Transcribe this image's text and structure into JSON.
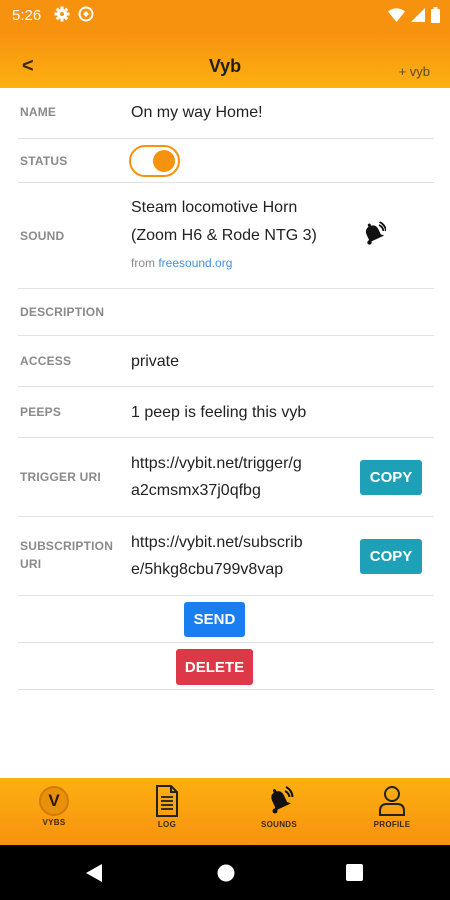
{
  "status_bar": {
    "time": "5:26"
  },
  "header": {
    "back_label": "<",
    "title": "Vyb",
    "add_label": "+ vyb"
  },
  "details": {
    "name": {
      "label": "NAME",
      "value": "On my way Home!"
    },
    "status": {
      "label": "STATUS",
      "enabled": true
    },
    "sound": {
      "label": "SOUND",
      "value_line1": "Steam locomotive Horn",
      "value_line2": "(Zoom H6 & Rode NTG 3)",
      "source_prefix": "from",
      "source_link": "freesound.org"
    },
    "description": {
      "label": "DESCRIPTION",
      "value": ""
    },
    "access": {
      "label": "ACCESS",
      "value": "private"
    },
    "peeps": {
      "label": "PEEPS",
      "value": "1 peep is feeling this vyb"
    },
    "trigger_uri": {
      "label": "TRIGGER URI",
      "value_line1": "https://vybit.net/trigger/g",
      "value_line2": "a2cmsmx37j0qfbg",
      "copy_label": "COPY"
    },
    "subscription_uri": {
      "label_line1": "SUBSCRIPTION",
      "label_line2": "URI",
      "value_line1": "https://vybit.net/subscrib",
      "value_line2": "e/5hkg8cbu799v8vap",
      "copy_label": "COPY"
    }
  },
  "actions": {
    "send_label": "SEND",
    "delete_label": "DELETE"
  },
  "bottom_nav": [
    {
      "label": "VYBS",
      "icon": "vybs-logo-icon",
      "badge": "V"
    },
    {
      "label": "LOG",
      "icon": "document-icon"
    },
    {
      "label": "SOUNDS",
      "icon": "bell-sound-icon"
    },
    {
      "label": "PROFILE",
      "icon": "person-icon"
    }
  ],
  "colors": {
    "accent": "#f7920f",
    "copy_button": "#1ea0b8",
    "send_button": "#1a7ef0",
    "delete_button": "#dc3848",
    "link": "#4a90d9"
  }
}
